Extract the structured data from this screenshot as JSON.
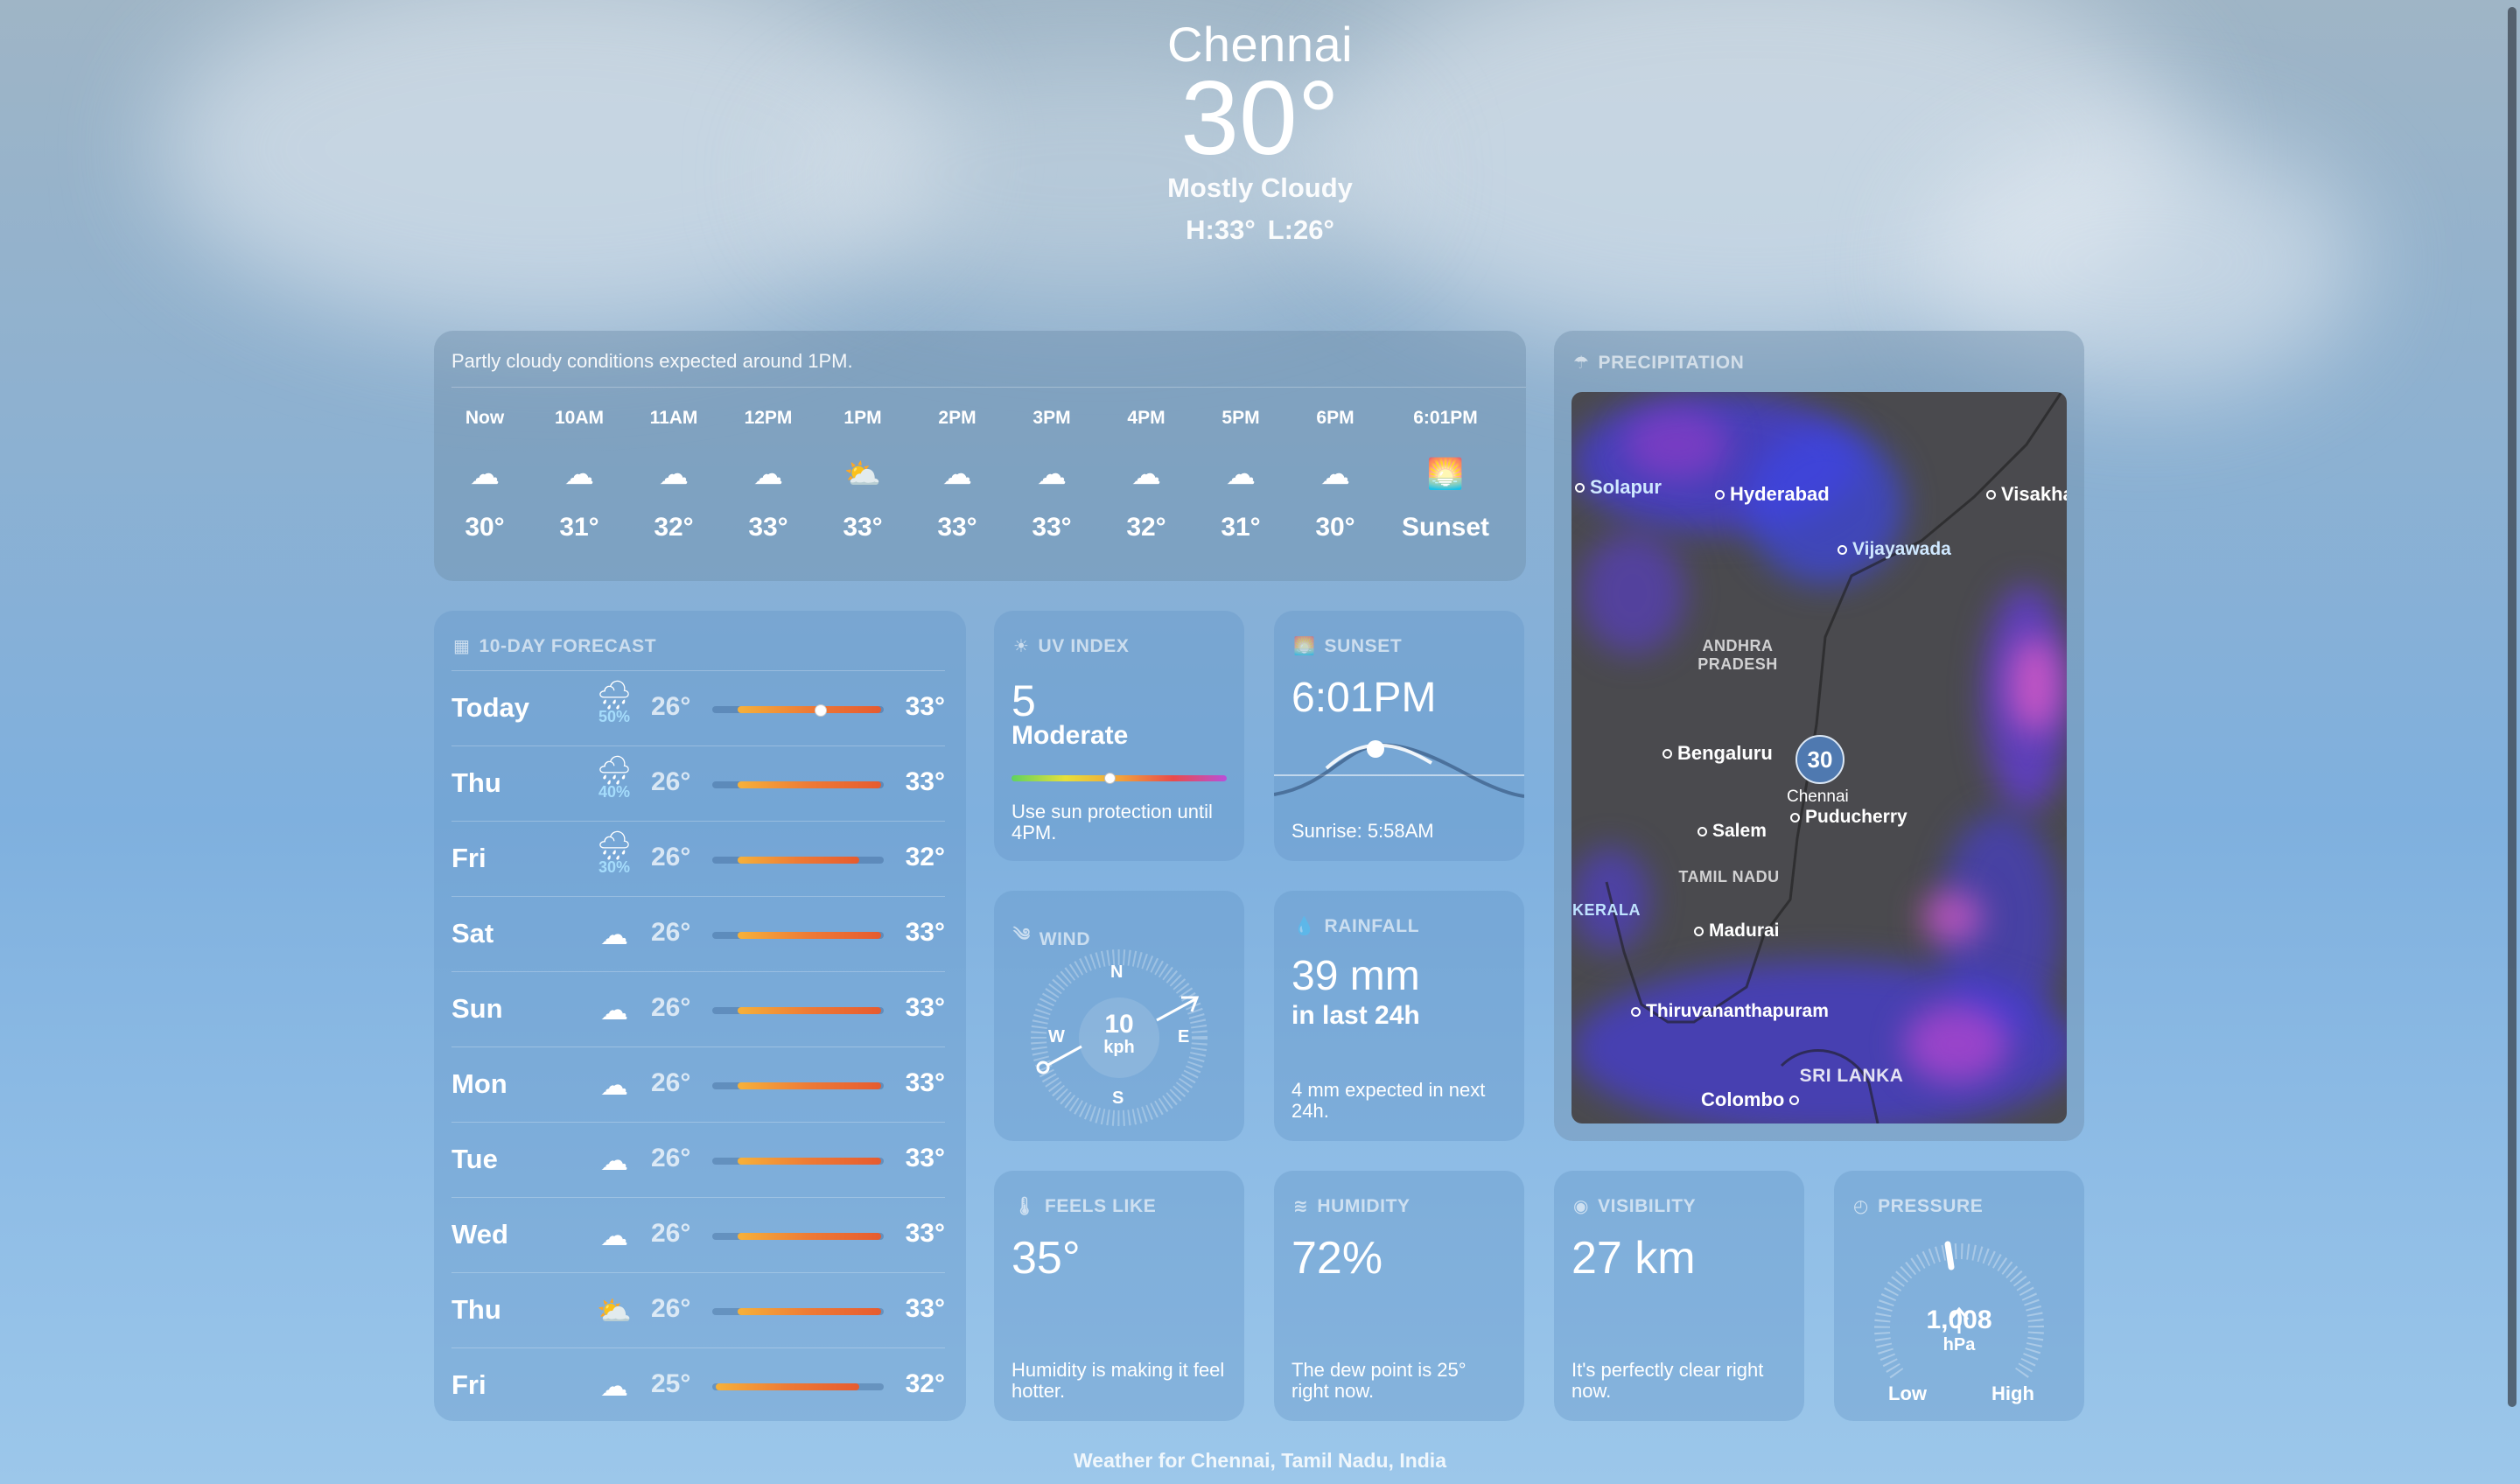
{
  "location": {
    "city": "Chennai",
    "temperature": "30°",
    "condition": "Mostly Cloudy",
    "high": "H:33°",
    "low": "L:26°"
  },
  "hourly": {
    "summary": "Partly cloudy conditions expected around 1PM.",
    "items": [
      {
        "time": "Now",
        "icon": "cloud-icon",
        "glyph": "☁",
        "temp": "30°"
      },
      {
        "time": "10AM",
        "icon": "cloud-icon",
        "glyph": "☁",
        "temp": "31°"
      },
      {
        "time": "11AM",
        "icon": "cloud-icon",
        "glyph": "☁",
        "temp": "32°"
      },
      {
        "time": "12PM",
        "icon": "cloud-icon",
        "glyph": "☁",
        "temp": "33°"
      },
      {
        "time": "1PM",
        "icon": "partly-cloudy-icon",
        "glyph": "⛅",
        "temp": "33°"
      },
      {
        "time": "2PM",
        "icon": "cloud-icon",
        "glyph": "☁",
        "temp": "33°"
      },
      {
        "time": "3PM",
        "icon": "cloud-icon",
        "glyph": "☁",
        "temp": "33°"
      },
      {
        "time": "4PM",
        "icon": "cloud-icon",
        "glyph": "☁",
        "temp": "32°"
      },
      {
        "time": "5PM",
        "icon": "cloud-icon",
        "glyph": "☁",
        "temp": "31°"
      },
      {
        "time": "6PM",
        "icon": "cloud-icon",
        "glyph": "☁",
        "temp": "30°"
      },
      {
        "time": "6:01PM",
        "icon": "sunset-icon",
        "glyph": "🌅",
        "temp": "Sunset"
      }
    ]
  },
  "forecast": {
    "title": "10-DAY FORECAST",
    "range": [
      25,
      33
    ],
    "days": [
      {
        "day": "Today",
        "icon": "rain-icon",
        "glyph": "🌧",
        "precip": "50%",
        "low": "26°",
        "high": "33°",
        "lo": 26,
        "hi": 33,
        "current": 30
      },
      {
        "day": "Thu",
        "icon": "rain-icon",
        "glyph": "🌧",
        "precip": "40%",
        "low": "26°",
        "high": "33°",
        "lo": 26,
        "hi": 33
      },
      {
        "day": "Fri",
        "icon": "rain-icon",
        "glyph": "🌧",
        "precip": "30%",
        "low": "26°",
        "high": "32°",
        "lo": 26,
        "hi": 32
      },
      {
        "day": "Sat",
        "icon": "cloud-icon",
        "glyph": "☁",
        "precip": "",
        "low": "26°",
        "high": "33°",
        "lo": 26,
        "hi": 33
      },
      {
        "day": "Sun",
        "icon": "cloud-icon",
        "glyph": "☁",
        "precip": "",
        "low": "26°",
        "high": "33°",
        "lo": 26,
        "hi": 33
      },
      {
        "day": "Mon",
        "icon": "cloud-icon",
        "glyph": "☁",
        "precip": "",
        "low": "26°",
        "high": "33°",
        "lo": 26,
        "hi": 33
      },
      {
        "day": "Tue",
        "icon": "cloud-icon",
        "glyph": "☁",
        "precip": "",
        "low": "26°",
        "high": "33°",
        "lo": 26,
        "hi": 33
      },
      {
        "day": "Wed",
        "icon": "cloud-icon",
        "glyph": "☁",
        "precip": "",
        "low": "26°",
        "high": "33°",
        "lo": 26,
        "hi": 33
      },
      {
        "day": "Thu",
        "icon": "partly-cloudy-icon",
        "glyph": "⛅",
        "precip": "",
        "low": "26°",
        "high": "33°",
        "lo": 26,
        "hi": 33
      },
      {
        "day": "Fri",
        "icon": "cloud-icon",
        "glyph": "☁",
        "precip": "",
        "low": "25°",
        "high": "32°",
        "lo": 25,
        "hi": 32
      }
    ]
  },
  "uv": {
    "title": "UV INDEX",
    "value": "5",
    "level": "Moderate",
    "desc": "Use sun protection until 4PM.",
    "fraction": 0.45
  },
  "sunset": {
    "title": "SUNSET",
    "time": "6:01PM",
    "sunrise": "Sunrise: 5:58AM"
  },
  "wind": {
    "title": "WIND",
    "speed": "10",
    "unit": "kph",
    "n": "N",
    "e": "E",
    "s": "S",
    "w": "W"
  },
  "rainfall": {
    "title": "RAINFALL",
    "amount": "39 mm",
    "period": "in last 24h",
    "desc": "4 mm expected in next 24h."
  },
  "feels_like": {
    "title": "FEELS LIKE",
    "value": "35°",
    "desc": "Humidity is making it feel hotter."
  },
  "humidity": {
    "title": "HUMIDITY",
    "value": "72%",
    "desc": "The dew point is 25° right now."
  },
  "visibility": {
    "title": "VISIBILITY",
    "value": "27 km",
    "desc": "It's perfectly clear right now."
  },
  "pressure": {
    "title": "PRESSURE",
    "value": "1,008",
    "unit": "hPa",
    "low": "Low",
    "high": "High"
  },
  "precipitation": {
    "title": "PRECIPITATION",
    "marker_temp": "30",
    "cities": [
      "Solapur",
      "Hyderabad",
      "Visakha",
      "Vijayawada",
      "Bengaluru",
      "Chennai",
      "Puducherry",
      "Salem",
      "Madurai",
      "Thiruvananthapuram",
      "Colombo"
    ],
    "regions": [
      "ANDHRA PRADESH",
      "TAMIL NADU",
      "KERALA",
      "SRI LANKA"
    ]
  },
  "footer": "Weather for Chennai, Tamil Nadu, India"
}
